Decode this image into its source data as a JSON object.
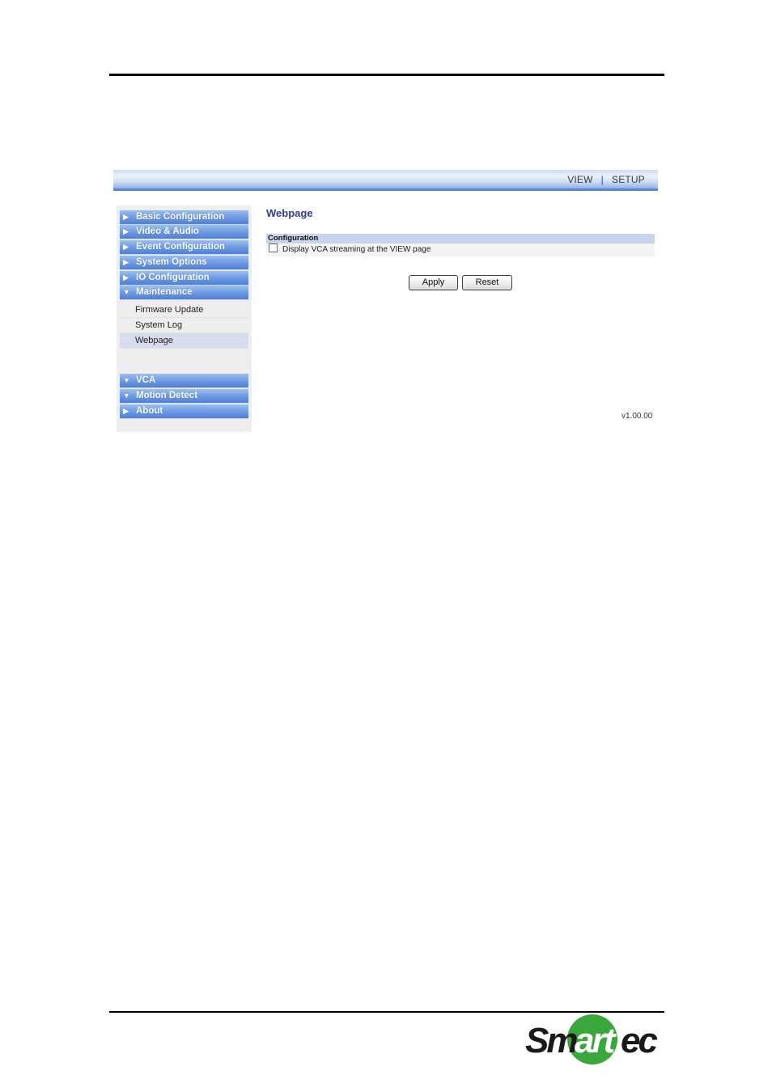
{
  "topnav": {
    "view_label": "VIEW",
    "separator": "|",
    "setup_label": "SETUP"
  },
  "sidebar": {
    "items": [
      {
        "label": "Basic Configuration",
        "arrow": "▶"
      },
      {
        "label": "Video & Audio",
        "arrow": "▶"
      },
      {
        "label": "Event Configuration",
        "arrow": "▶"
      },
      {
        "label": "System Options",
        "arrow": "▶"
      },
      {
        "label": "IO Configuration",
        "arrow": "▶"
      },
      {
        "label": "Maintenance",
        "arrow": "▼"
      }
    ],
    "maintenance_subitems": [
      {
        "label": "Firmware Update"
      },
      {
        "label": "System Log"
      },
      {
        "label": "Webpage"
      }
    ],
    "lower_items": [
      {
        "label": "VCA",
        "arrow": "▼"
      },
      {
        "label": "Motion Detect",
        "arrow": "▼"
      },
      {
        "label": "About",
        "arrow": "▶"
      }
    ]
  },
  "main": {
    "title": "Webpage",
    "config_header": "Configuration",
    "checkbox_label": "Display VCA streaming at the VIEW page",
    "apply_label": "Apply",
    "reset_label": "Reset",
    "version": "v1.00.00"
  },
  "logo": {
    "text": "Smartec",
    "colors": {
      "dark": "#1a1a1a",
      "green": "#3aa73a"
    }
  }
}
